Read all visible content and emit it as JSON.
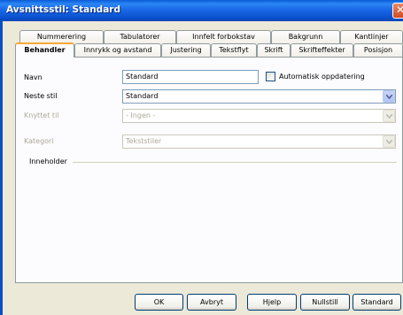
{
  "window": {
    "title": "Avsnittsstil: Standard"
  },
  "tabs_row1": [
    "Nummerering",
    "Tabulatorer",
    "Innfelt forbokstav",
    "Bakgrunn",
    "Kantlinjer"
  ],
  "tabs_row2": [
    "Behandler",
    "Innrykk og avstand",
    "Justering",
    "Tekstflyt",
    "Skrift",
    "Skrifteffekter",
    "Posisjon"
  ],
  "form": {
    "name_label": "Navn",
    "name_value": "Standard",
    "auto_update_label": "Automatisk oppdatering",
    "next_style_label": "Neste stil",
    "next_style_value": "Standard",
    "linked_label": "Knyttet til",
    "linked_value": "- Ingen -",
    "category_label": "Kategori",
    "category_value": "Tekststiler",
    "contains_label": "Inneholder"
  },
  "buttons": {
    "ok": "OK",
    "cancel": "Avbryt",
    "help": "Hjelp",
    "reset": "Nullstill",
    "standard": "Standard"
  }
}
